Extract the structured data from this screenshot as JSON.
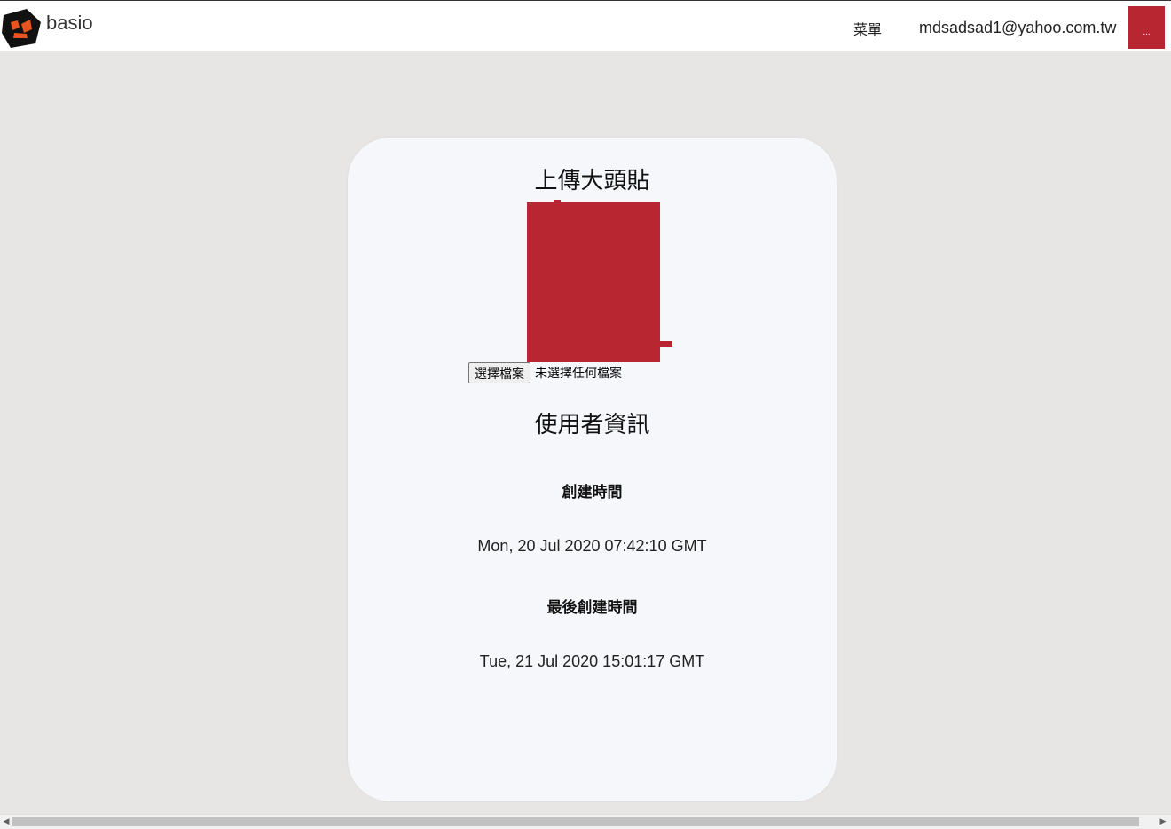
{
  "navbar": {
    "brand_name": "basio",
    "menu_label": "菜單",
    "user_email": "mdsadsad1@yahoo.com.tw",
    "avatar_button_label": "...",
    "avatar_color": "#b82631"
  },
  "card": {
    "upload_title": "上傳大頭貼",
    "file_input": {
      "button_label": "選擇檔案",
      "status_text": "未選擇任何檔案"
    },
    "info_title": "使用者資訊",
    "created_label": "創建時間",
    "created_value": "Mon, 20 Jul 2020 07:42:10 GMT",
    "last_label": "最後創建時間",
    "last_value": "Tue, 21 Jul 2020 15:01:17 GMT"
  },
  "scrollbar": {
    "left_arrow": "◀",
    "right_arrow": "▶"
  },
  "icons": {
    "brand_logo": "basio-logo-icon"
  }
}
